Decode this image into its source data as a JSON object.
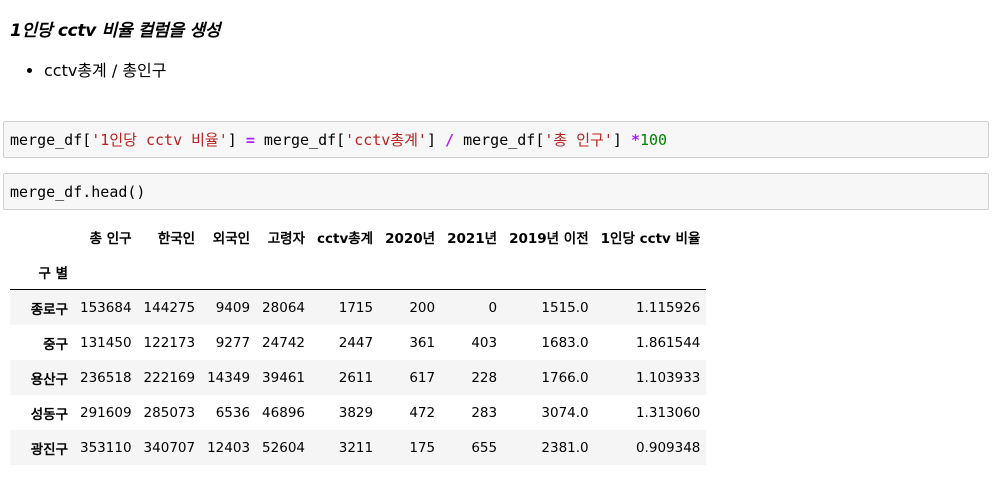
{
  "markdown": {
    "heading": "1인당 cctv 비율 컬럼을 생성",
    "bullets": [
      "cctv총계 / 총인구"
    ]
  },
  "cells": [
    {
      "tokens": [
        {
          "t": "plain",
          "v": "merge_df["
        },
        {
          "t": "str",
          "v": "'1인당 cctv 비율'"
        },
        {
          "t": "plain",
          "v": "] "
        },
        {
          "t": "op",
          "v": "="
        },
        {
          "t": "plain",
          "v": " merge_df["
        },
        {
          "t": "str",
          "v": "'cctv총계'"
        },
        {
          "t": "plain",
          "v": "] "
        },
        {
          "t": "op",
          "v": "/"
        },
        {
          "t": "plain",
          "v": " merge_df["
        },
        {
          "t": "str",
          "v": "'총 인구'"
        },
        {
          "t": "plain",
          "v": "] "
        },
        {
          "t": "op",
          "v": "*"
        },
        {
          "t": "num",
          "v": "100"
        }
      ]
    },
    {
      "tokens": [
        {
          "t": "plain",
          "v": "merge_df.head()"
        }
      ]
    }
  ],
  "dataframe": {
    "index_name": "구 별",
    "columns": [
      "총 인구",
      "한국인",
      "외국인",
      "고령자",
      "cctv총계",
      "2020년",
      "2021년",
      "2019년 이전",
      "1인당 cctv 비율"
    ],
    "rows": [
      {
        "index": "종로구",
        "values": [
          "153684",
          "144275",
          "9409",
          "28064",
          "1715",
          "200",
          "0",
          "1515.0",
          "1.115926"
        ]
      },
      {
        "index": "중구",
        "values": [
          "131450",
          "122173",
          "9277",
          "24742",
          "2447",
          "361",
          "403",
          "1683.0",
          "1.861544"
        ]
      },
      {
        "index": "용산구",
        "values": [
          "236518",
          "222169",
          "14349",
          "39461",
          "2611",
          "617",
          "228",
          "1766.0",
          "1.103933"
        ]
      },
      {
        "index": "성동구",
        "values": [
          "291609",
          "285073",
          "6536",
          "46896",
          "3829",
          "472",
          "283",
          "3074.0",
          "1.313060"
        ]
      },
      {
        "index": "광진구",
        "values": [
          "353110",
          "340707",
          "12403",
          "52604",
          "3211",
          "175",
          "655",
          "2381.0",
          "0.909348"
        ]
      }
    ]
  }
}
